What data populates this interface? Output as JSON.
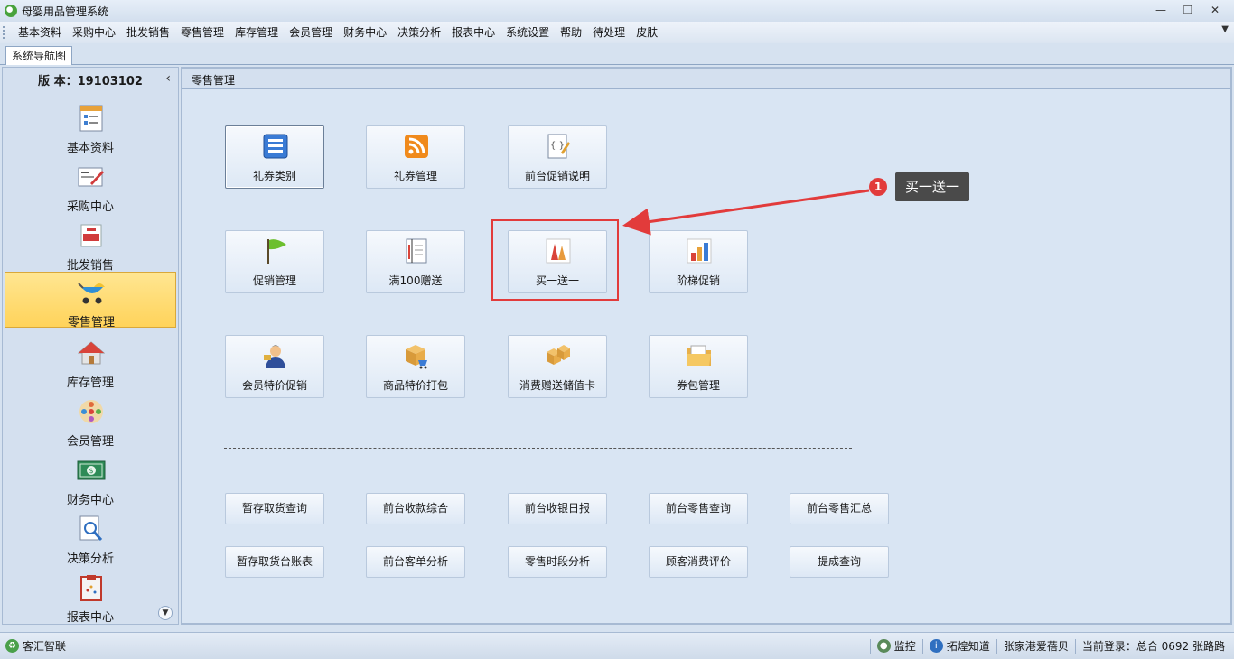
{
  "window": {
    "title": "母婴用品管理系统"
  },
  "menu": [
    "基本资料",
    "采购中心",
    "批发销售",
    "零售管理",
    "库存管理",
    "会员管理",
    "财务中心",
    "决策分析",
    "报表中心",
    "系统设置",
    "帮助",
    "待处理",
    "皮肤"
  ],
  "tab": {
    "label": "系统导航图"
  },
  "sidebar": {
    "version": "版 本：19103102",
    "items": [
      {
        "label": "基本资料",
        "icon": "document-list-icon"
      },
      {
        "label": "采购中心",
        "icon": "purchase-order-icon"
      },
      {
        "label": "批发销售",
        "icon": "sale-tag-icon"
      },
      {
        "label": "零售管理",
        "icon": "stroller-icon",
        "active": true
      },
      {
        "label": "库存管理",
        "icon": "house-icon"
      },
      {
        "label": "会员管理",
        "icon": "members-icon"
      },
      {
        "label": "财务中心",
        "icon": "money-icon"
      },
      {
        "label": "决策分析",
        "icon": "analysis-icon"
      },
      {
        "label": "报表中心",
        "icon": "report-clipboard-icon"
      }
    ]
  },
  "main": {
    "title": "零售管理",
    "big_buttons": [
      {
        "label": "礼券类别",
        "icon": "list-icon"
      },
      {
        "label": "礼券管理",
        "icon": "rss-icon"
      },
      {
        "label": "前台促销说明",
        "icon": "code-doc-icon"
      },
      {
        "label": "促销管理",
        "icon": "flag-icon"
      },
      {
        "label": "满100赠送",
        "icon": "ledger-icon"
      },
      {
        "label": "买一送一",
        "icon": "cones-icon"
      },
      {
        "label": "阶梯促销",
        "icon": "bar-chart-icon"
      },
      {
        "label": "会员特价促销",
        "icon": "member-person-icon"
      },
      {
        "label": "商品特价打包",
        "icon": "box-cart-icon"
      },
      {
        "label": "消费赠送储值卡",
        "icon": "boxes-icon"
      },
      {
        "label": "券包管理",
        "icon": "folder-icon"
      }
    ],
    "small_buttons": [
      "暂存取货查询",
      "前台收款综合",
      "前台收银日报",
      "前台零售查询",
      "前台零售汇总",
      "暂存取货台账表",
      "前台客单分析",
      "零售时段分析",
      "顾客消费评价",
      "提成查询"
    ]
  },
  "annotation": {
    "badge": "1",
    "callout": "买一送一",
    "color": "#e23b3b"
  },
  "status": {
    "company": "客汇智联",
    "monitor": "监控",
    "help": "拓煌知道",
    "store": "张家港爱蓓贝",
    "login": "当前登录：总合 0692 张路路"
  }
}
